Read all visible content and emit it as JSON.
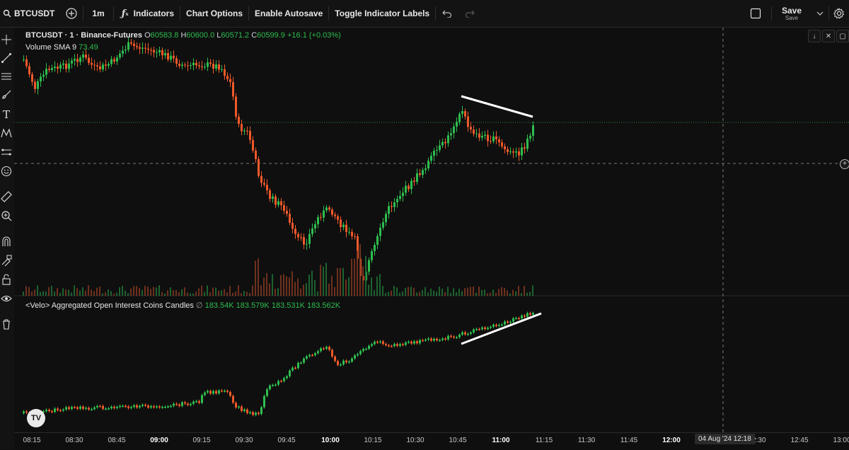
{
  "topbar": {
    "symbol": "BTCUSDT",
    "interval": "1m",
    "indicators": "Indicators",
    "chart_options": "Chart Options",
    "autosave": "Enable Autosave",
    "toggle_labels": "Toggle Indicator Labels",
    "save": "Save",
    "save_sub": "Save"
  },
  "legend": {
    "title": "BTCUSDT · 1 · Binance-Futures",
    "o_label": "O",
    "o_value": "60583.8",
    "h_label": "H",
    "h_value": "60600.0",
    "l_label": "L",
    "l_value": "60571.2",
    "c_label": "C",
    "c_value": "60599.9",
    "change": "+16.1 (+0.03%)",
    "volume_label": "Volume SMA 9",
    "volume_value": "73.49",
    "oi_label": "<Velo> Aggregated Open Interest Coins Candles",
    "oi_icon": "∅",
    "oi_v1": "183.54K",
    "oi_v2": "183.579K",
    "oi_v3": "183.531K",
    "oi_v4": "183.562K"
  },
  "xaxis": {
    "labels": [
      "08:15",
      "08:30",
      "08:45",
      "09:00",
      "09:15",
      "09:30",
      "09:45",
      "10:00",
      "10:15",
      "10:30",
      "10:45",
      "11:00",
      "11:15",
      "11:30",
      "11:45",
      "12:00",
      "12:30",
      "12:45",
      "13:00"
    ],
    "bold": [
      "09:00",
      "10:00",
      "11:00",
      "12:00"
    ],
    "crosshair_label": "04 Aug '24   12:18"
  },
  "colors": {
    "up": "#2ebd4f",
    "down": "#f0592a",
    "background": "#0f0f0f"
  },
  "icons": [
    "search-icon",
    "plus-circle-icon",
    "function-icon",
    "undo-icon",
    "redo-icon",
    "checkbox-icon",
    "chevron-down-icon",
    "gear-icon",
    "crosshair-icon",
    "trendline-icon",
    "fib-icon",
    "brush-icon",
    "text-icon",
    "pattern-icon",
    "measure-icon",
    "emoji-icon",
    "ruler-icon",
    "zoom-in-icon",
    "magnet-icon",
    "lock-drawing-icon",
    "lock-icon",
    "eye-icon",
    "trash-icon",
    "tradingview-logo"
  ]
}
